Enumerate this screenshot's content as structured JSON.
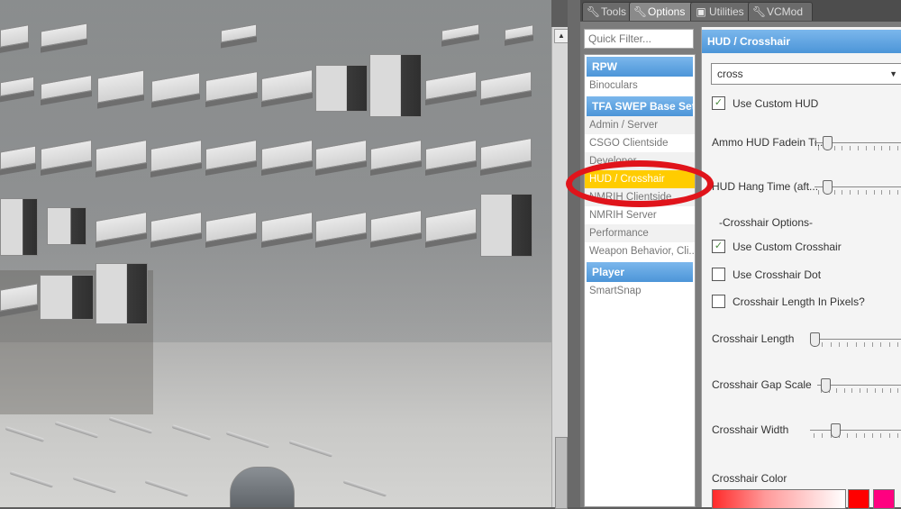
{
  "tabs": [
    {
      "label": "Tools",
      "icon": "wrench-icon"
    },
    {
      "label": "Options",
      "icon": "wrench-icon",
      "active": true
    },
    {
      "label": "Utilities",
      "icon": "utilities-icon"
    },
    {
      "label": "VCMod",
      "icon": "wrench-icon"
    }
  ],
  "filter": {
    "placeholder": "Quick Filter..."
  },
  "categories": [
    {
      "header": "RPW",
      "items": [
        "Binoculars"
      ]
    },
    {
      "header": "TFA SWEP Base Sett...",
      "items": [
        "Admin / Server",
        "CSGO Clientside",
        "Developer",
        "HUD / Crosshair",
        "NMRIH Clientside",
        "NMRIH Server",
        "Performance",
        "Weapon Behavior, Cli..."
      ]
    },
    {
      "header": "Player",
      "items": [
        "SmartSnap"
      ]
    }
  ],
  "selected_item": "HUD / Crosshair",
  "settings": {
    "title": "HUD / Crosshair",
    "preset_value": "cross",
    "use_custom_hud": "Use Custom HUD",
    "use_custom_hud_checked": true,
    "ammo_hud_fadein": "Ammo HUD Fadein Ti...",
    "hud_hang_time": "HUD Hang Time (aft...",
    "crosshair_options": "-Crosshair Options-",
    "use_custom_crosshair": "Use Custom Crosshair",
    "use_custom_crosshair_checked": true,
    "use_crosshair_dot": "Use Crosshair Dot",
    "use_crosshair_dot_checked": false,
    "crosshair_length_pixels": "Crosshair Length In Pixels?",
    "crosshair_length_pixels_checked": false,
    "crosshair_length": "Crosshair Length",
    "crosshair_gap_scale": "Crosshair Gap Scale",
    "crosshair_width": "Crosshair Width",
    "crosshair_color": "Crosshair Color"
  },
  "slider_levels": {
    "ammo_hud_fadein": 0.1,
    "hud_hang_time": 0.1,
    "crosshair_length": 0.0,
    "crosshair_gap_scale": 0.05,
    "crosshair_width": 0.25
  },
  "colors": {
    "accent_blue": "#4c95d8",
    "selected_yellow": "#ffcc00",
    "annotation_red": "#e0141b",
    "swatch_red": "#ff0000",
    "swatch_pink": "#ff0080"
  }
}
